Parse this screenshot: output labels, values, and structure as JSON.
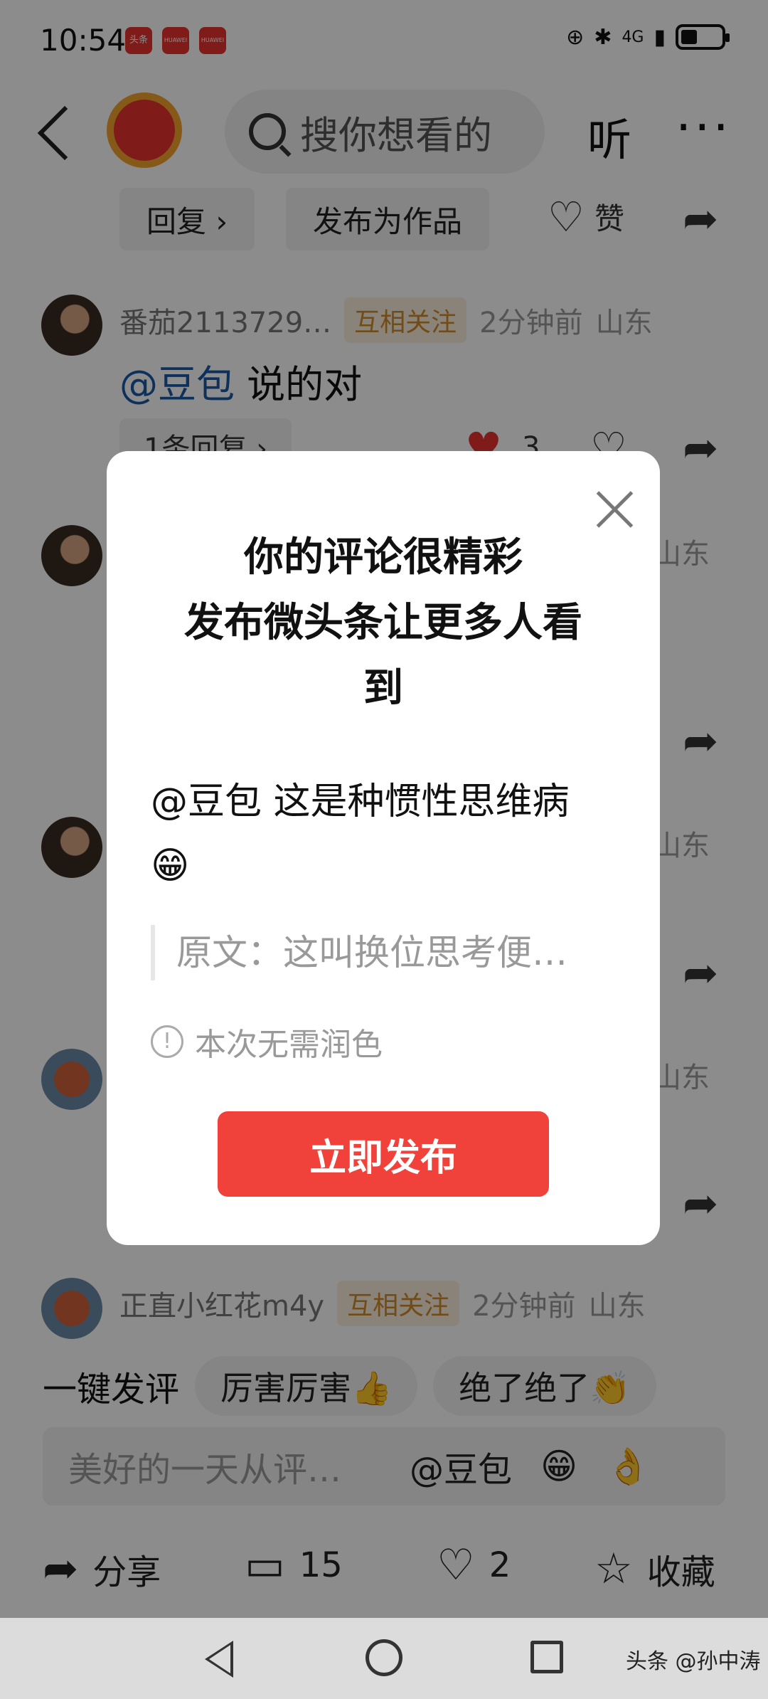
{
  "status_bar": {
    "time": "10:54",
    "apps": [
      "头条",
      "HUAWEI",
      "HUAWEI"
    ],
    "network": "4G"
  },
  "header": {
    "search_placeholder": "搜你想看的",
    "listen_label": "听",
    "more_label": "···"
  },
  "actions": {
    "reply_label": "回复 ›",
    "publish_as_work_label": "发布为作品",
    "like_label": "赞"
  },
  "comments": [
    {
      "name": "番茄2113729…",
      "badge": "互相关注",
      "time": "2分钟前",
      "location": "山东",
      "mention": "@豆包",
      "text": "说的对",
      "reply_count_label": "1条回复 ›",
      "likes": "3"
    },
    {
      "location": "山东"
    },
    {
      "location": "山东"
    },
    {
      "location": "山东"
    },
    {
      "name": "正直小红花m4y",
      "badge": "互相关注",
      "time": "2分钟前",
      "location": "山东"
    }
  ],
  "quick_comment": {
    "label": "一键发评",
    "chips": [
      "厉害厉害👍",
      "绝了绝了👏"
    ]
  },
  "input_bar": {
    "placeholder": "美好的一天从评…",
    "mention": "@豆包",
    "emojis": [
      "😁",
      "👌"
    ]
  },
  "bottom_actions": {
    "share_label": "分享",
    "comment_count": "15",
    "like_count": "2",
    "favorite_label": "收藏"
  },
  "watermark": "头条 @孙中涛",
  "modal": {
    "title_line1": "你的评论很精彩",
    "title_line2": "发布微头条让更多人看",
    "title_line3": "到",
    "body_text": "@豆包 这是种惯性思维病",
    "body_emoji": "😁",
    "original": "原文：这叫换位思考便…",
    "note": "本次无需润色",
    "publish_button": "立即发布"
  },
  "colors": {
    "accent": "#f0413b",
    "mention": "#1a5aa6",
    "badge": "#d08a2a"
  }
}
